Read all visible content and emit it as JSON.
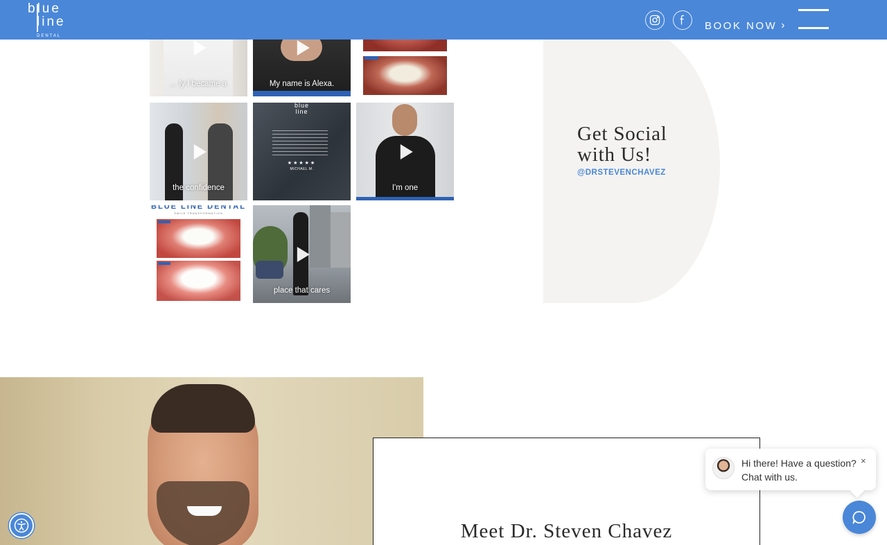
{
  "header": {
    "logo": {
      "line1": "blue",
      "line2": "line",
      "line3": "DENTAL"
    },
    "book_now_label": "BOOK NOW",
    "book_now_chevron": "›",
    "icons": {
      "instagram": "instagram-icon",
      "facebook": "facebook-icon",
      "menu": "hamburger-menu-icon"
    },
    "accent_color": "#4a87d8"
  },
  "instagram_grid": {
    "tiles": [
      {
        "caption": "... ly I became a",
        "type": "video"
      },
      {
        "caption": "My name is Alexa.",
        "type": "video"
      },
      {
        "caption": "",
        "type": "image"
      },
      {
        "caption": "the confidence",
        "type": "video"
      },
      {
        "caption": "",
        "type": "image",
        "logo_top": "blue\nline",
        "stars": "★★★★★",
        "name": "MICHAEL M."
      },
      {
        "caption": "I'm one",
        "type": "video"
      },
      {
        "caption": "",
        "type": "image",
        "brand": "BLUE LINE DENTAL",
        "sub": "SMILE TRANSFORMATION"
      },
      {
        "caption": "place that cares",
        "type": "video"
      }
    ]
  },
  "social": {
    "title_line1": "Get Social",
    "title_line2": "with Us!",
    "handle": "@DRSTEVENCHAVEZ"
  },
  "meet": {
    "title": "Meet Dr. Steven Chavez"
  },
  "chat": {
    "message_line1": "Hi there! Have a question?",
    "message_line2": "Chat with us.",
    "close": "×"
  }
}
